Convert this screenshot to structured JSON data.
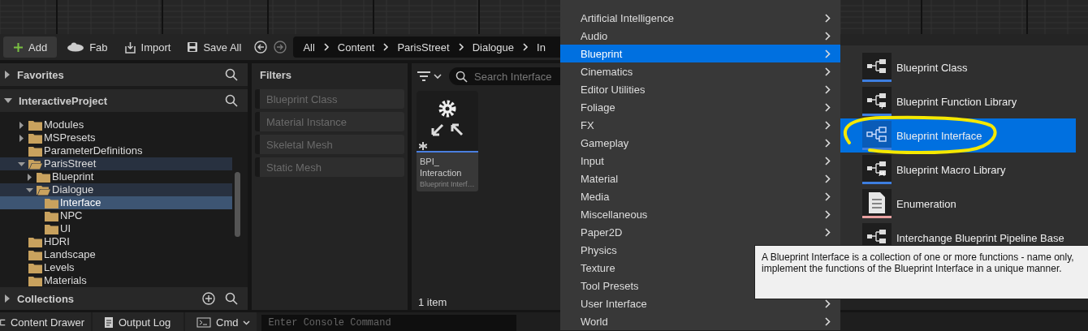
{
  "toolbar": {
    "buttons": [
      {
        "kind": "add",
        "label": "Add"
      },
      {
        "kind": "fab",
        "label": "Fab"
      },
      {
        "kind": "import",
        "label": "Import"
      },
      {
        "kind": "save",
        "label": "Save All"
      }
    ],
    "breadcrumb": [
      "All",
      "Content",
      "ParisStreet",
      "Dialogue",
      "In"
    ]
  },
  "sidebar": {
    "favorites": {
      "title": "Favorites",
      "expanded": false
    },
    "project": {
      "title": "InteractiveProject",
      "expanded": true
    },
    "tree": [
      {
        "label": "Modules",
        "kind": "branch",
        "expanded": false,
        "selected": false
      },
      {
        "label": "MSPresets",
        "kind": "branch",
        "expanded": false,
        "selected": false
      },
      {
        "label": "ParameterDefinitions",
        "kind": "leaf",
        "expanded": false,
        "selected": false
      },
      {
        "label": "ParisStreet",
        "kind": "branch",
        "expanded": true,
        "selected": false,
        "children": [
          {
            "label": "Blueprint",
            "kind": "branch",
            "expanded": false,
            "selected": false
          },
          {
            "label": "Dialogue",
            "kind": "branch",
            "expanded": true,
            "selected": false,
            "children": [
              {
                "label": "Interface",
                "kind": "leaf",
                "expanded": false,
                "selected": true
              },
              {
                "label": "NPC",
                "kind": "leaf",
                "expanded": false,
                "selected": false
              },
              {
                "label": "UI",
                "kind": "leaf",
                "expanded": false,
                "selected": false
              }
            ]
          }
        ]
      },
      {
        "label": "HDRI",
        "kind": "leaf",
        "expanded": false,
        "selected": false
      },
      {
        "label": "Landscape",
        "kind": "leaf",
        "expanded": false,
        "selected": false
      },
      {
        "label": "Levels",
        "kind": "leaf",
        "expanded": false,
        "selected": false
      },
      {
        "label": "Materials",
        "kind": "leaf",
        "expanded": false,
        "selected": false
      }
    ],
    "collections": {
      "title": "Collections",
      "expanded": false
    }
  },
  "filters": {
    "title": "Filters",
    "items": [
      {
        "label": "Blueprint Class",
        "disabled": true
      },
      {
        "label": "Material Instance",
        "disabled": true
      },
      {
        "label": "Skeletal Mesh",
        "disabled": true
      },
      {
        "label": "Static Mesh",
        "disabled": true
      }
    ]
  },
  "content": {
    "search": {
      "placeholder": "Search Interface"
    },
    "assets": [
      {
        "name": "BPI_ Interaction",
        "type": "Blueprint Interf…"
      }
    ],
    "count": "1 item"
  },
  "menu": {
    "items": [
      {
        "label": "Artificial Intelligence",
        "selected": false
      },
      {
        "label": "Audio",
        "selected": false
      },
      {
        "label": "Blueprint",
        "selected": true
      },
      {
        "label": "Cinematics",
        "selected": false
      },
      {
        "label": "Editor Utilities",
        "selected": false
      },
      {
        "label": "Foliage",
        "selected": false
      },
      {
        "label": "FX",
        "selected": false
      },
      {
        "label": "Gameplay",
        "selected": false
      },
      {
        "label": "Input",
        "selected": false
      },
      {
        "label": "Material",
        "selected": false
      },
      {
        "label": "Media",
        "selected": false
      },
      {
        "label": "Miscellaneous",
        "selected": false
      },
      {
        "label": "Paper2D",
        "selected": false
      },
      {
        "label": "Physics",
        "selected": false
      },
      {
        "label": "Texture",
        "selected": false
      },
      {
        "label": "Tool Presets",
        "selected": false
      },
      {
        "label": "User Interface",
        "selected": false
      },
      {
        "label": "World",
        "selected": false
      }
    ]
  },
  "submenu": {
    "items": [
      {
        "label": "Blueprint Class",
        "kind": "class",
        "color": "#3d7ee0",
        "selected": false
      },
      {
        "label": "Blueprint Function Library",
        "kind": "function",
        "color": "#3d7ee0",
        "selected": false
      },
      {
        "label": "Blueprint Interface",
        "kind": "interface",
        "color": "#3d7ee0",
        "selected": true
      },
      {
        "label": "Blueprint Macro Library",
        "kind": "macro",
        "color": "#3d7ee0",
        "selected": false
      },
      {
        "label": "Enumeration",
        "kind": "enum",
        "color": "#e8a0a0",
        "selected": false
      },
      {
        "label": "Interchange Blueprint Pipeline Base",
        "kind": "class",
        "selected": false
      }
    ]
  },
  "tooltip": [
    "A Blueprint Interface is a collection of one or more functions - name only,",
    "implement the functions of the Blueprint Interface in a unique manner."
  ],
  "status_bar": {
    "items": [
      {
        "kind": "drawer",
        "label": "Content Drawer"
      },
      {
        "kind": "log",
        "label": "Output Log"
      },
      {
        "kind": "cmd",
        "label": "Cmd"
      }
    ],
    "console": {
      "placeholder": "Enter Console Command"
    }
  }
}
